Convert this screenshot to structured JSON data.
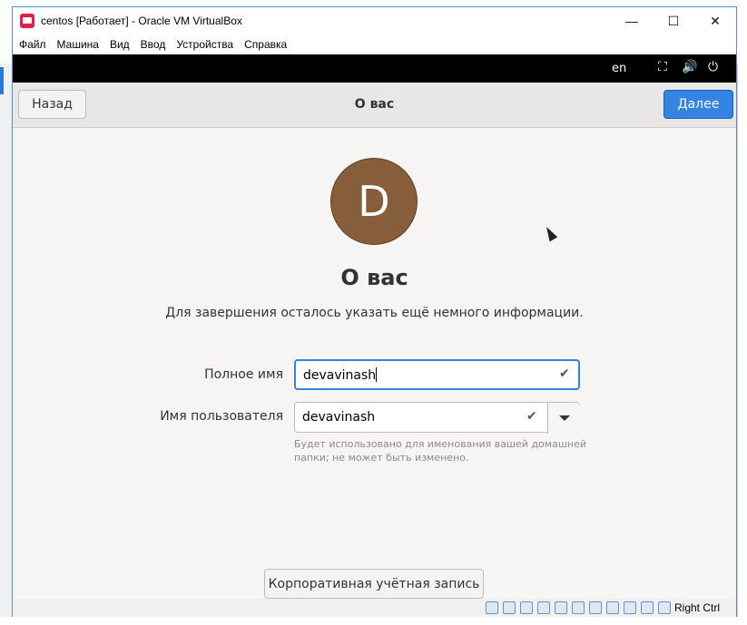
{
  "window": {
    "title": "centos [Работает] - Oracle VM VirtualBox",
    "controls": {
      "minimize": "—",
      "maximize": "☐",
      "close": "✕"
    }
  },
  "menu": [
    "Файл",
    "Машина",
    "Вид",
    "Ввод",
    "Устройства",
    "Справка"
  ],
  "guest_topbar": {
    "language": "en",
    "icons": [
      "network-icon",
      "volume-icon",
      "power-icon"
    ],
    "network_glyph": "⛶",
    "volume_glyph": "🔊",
    "power_glyph": "⏻"
  },
  "headerbar": {
    "back_label": "Назад",
    "title": "О вас",
    "next_label": "Далее"
  },
  "content": {
    "avatar_letter": "D",
    "avatar_color": "#865e3c",
    "title": "О вас",
    "subtitle": "Для завершения осталось указать ещё немного информации.",
    "full_name_label": "Полное имя",
    "full_name_value": "devavinash",
    "username_label": "Имя пользователя",
    "username_value": "devavinash",
    "check_glyph": "✔",
    "hint": "Будет использовано для именования вашей домашней папки; не может быть изменено.",
    "enterprise_button": "Корпоративная учётная запись"
  },
  "statusbar": {
    "host_key": "Right Ctrl"
  },
  "colors": {
    "accent": "#3584e4",
    "focus_border": "#3584e4"
  }
}
